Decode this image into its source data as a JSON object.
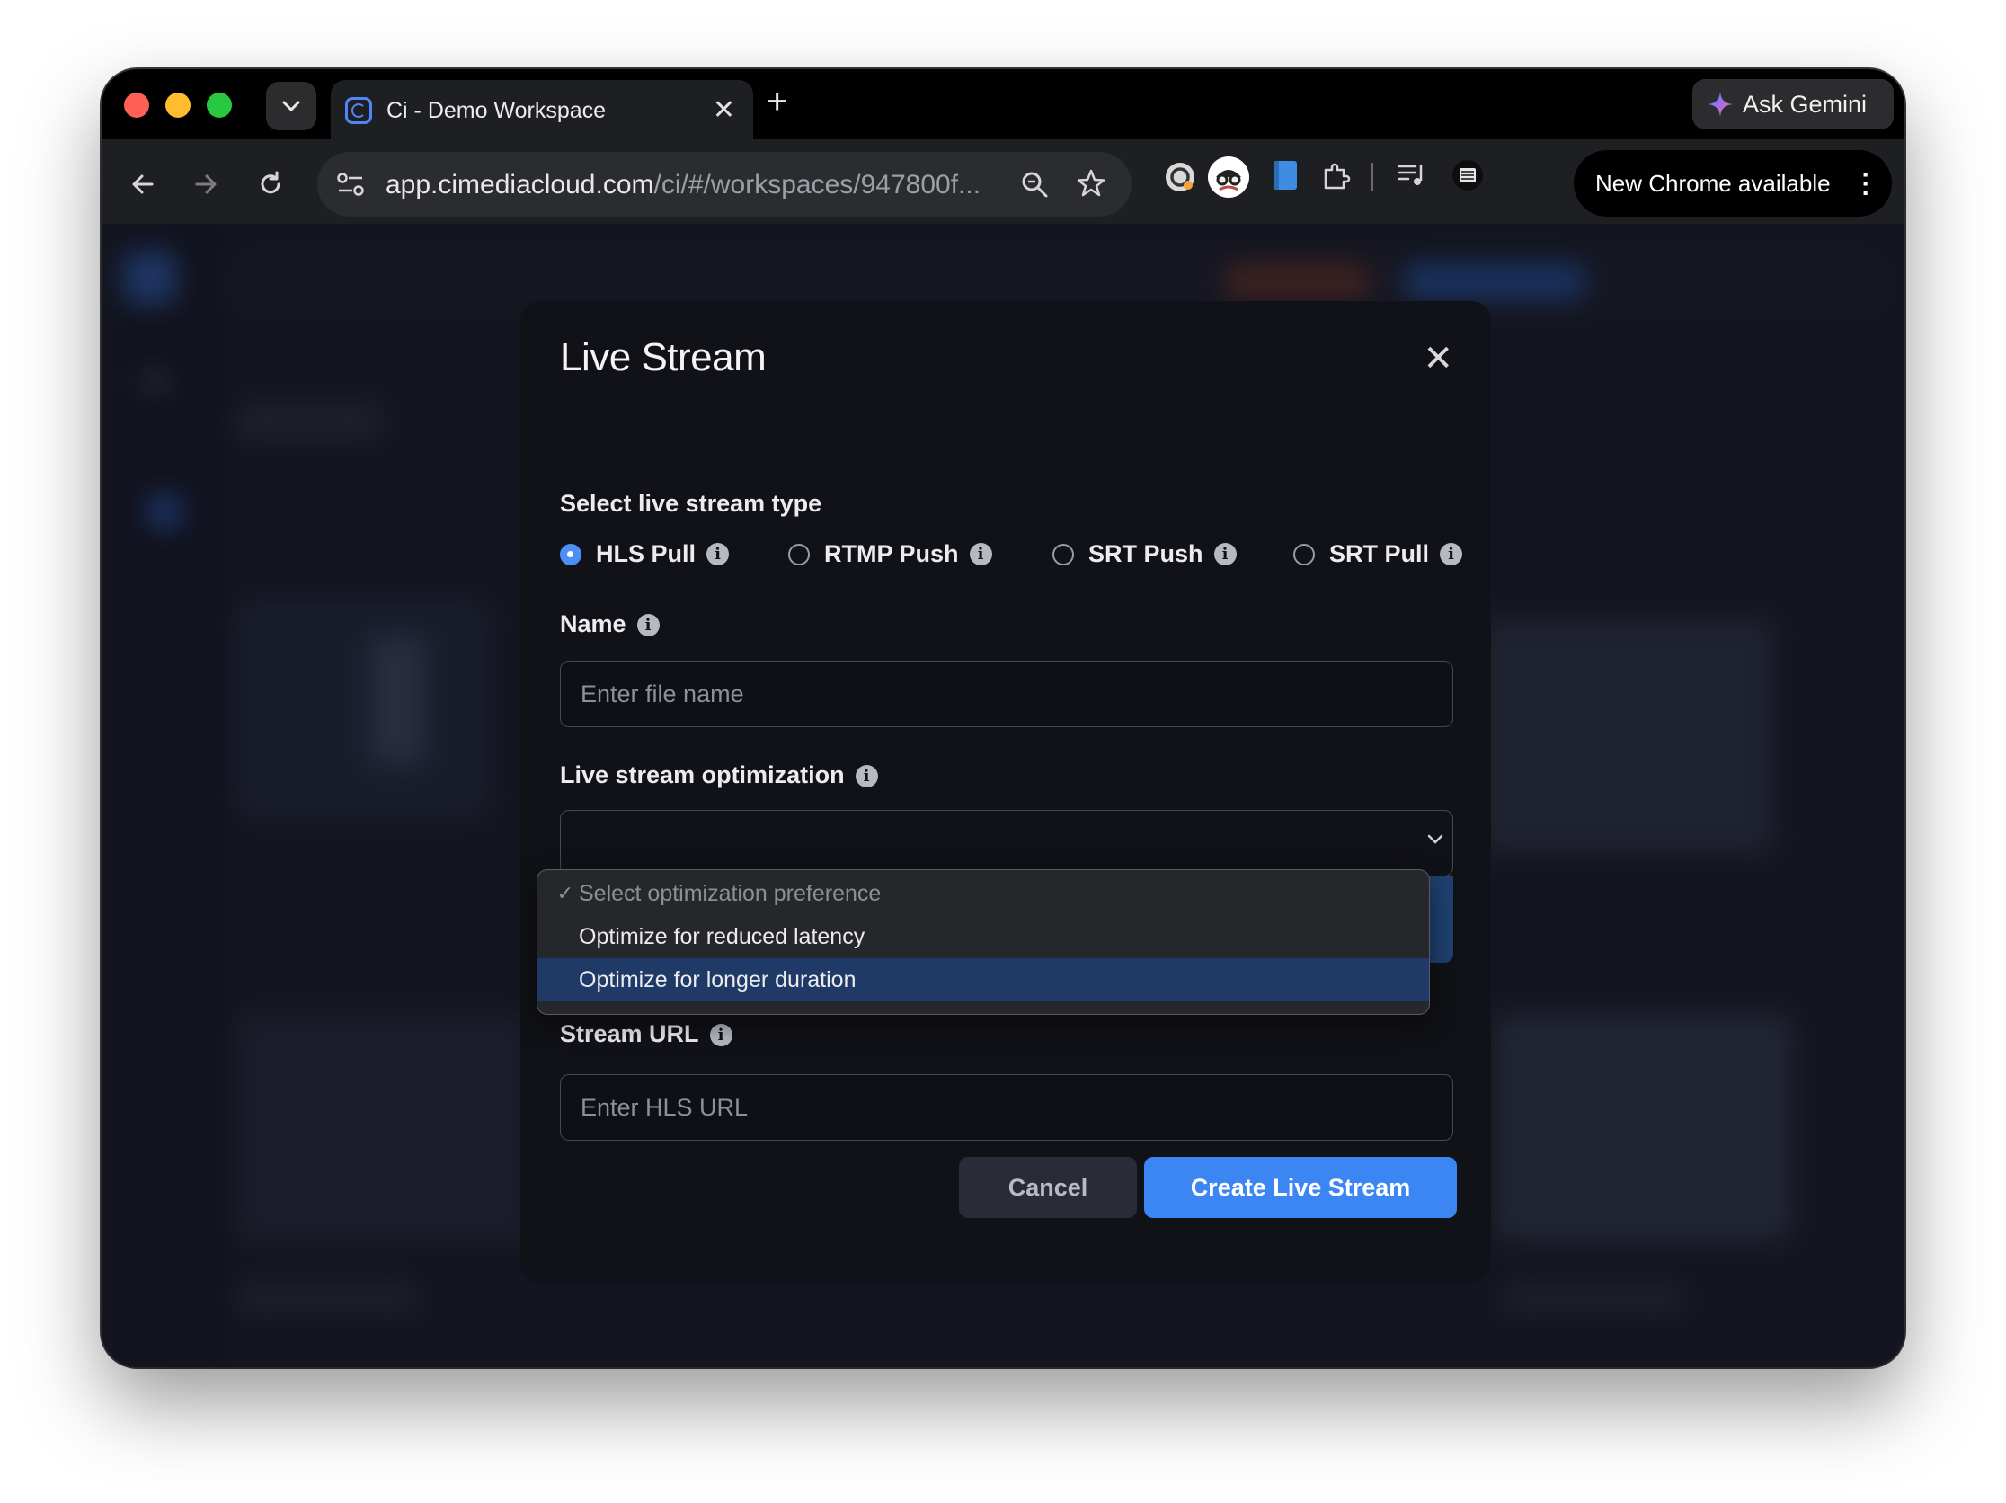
{
  "browser": {
    "tab": {
      "title": "Ci - Demo Workspace",
      "close_glyph": "✕"
    },
    "new_tab_glyph": "+",
    "ask_gemini_label": "Ask Gemini",
    "url_host": "app.cimediacloud.com",
    "url_path": "/ci/#/workspaces/947800f...",
    "update_label": "New Chrome available",
    "icons": [
      "tab-search-icon",
      "back-icon",
      "forward-icon",
      "reload-icon",
      "site-settings-icon",
      "zoom-icon",
      "bookmark-star-icon",
      "extension-icon",
      "puzzle-icon",
      "media-controls-icon",
      "menu-icon"
    ]
  },
  "modal": {
    "title": "Live Stream",
    "close_glyph": "✕",
    "stream_type_label": "Select live stream type",
    "stream_types": [
      {
        "label": "HLS Pull",
        "selected": true
      },
      {
        "label": "RTMP Push",
        "selected": false
      },
      {
        "label": "SRT Push",
        "selected": false
      },
      {
        "label": "SRT Pull",
        "selected": false
      }
    ],
    "name_label": "Name",
    "name_placeholder": "Enter file name",
    "optimization_label": "Live stream optimization",
    "optimization_options": [
      {
        "label": "Select optimization preference",
        "checked": true,
        "disabled": true
      },
      {
        "label": "Optimize for reduced latency",
        "checked": false
      },
      {
        "label": "Optimize for longer duration",
        "checked": false,
        "highlighted": true
      }
    ],
    "stream_url_label": "Stream URL",
    "stream_url_placeholder": "Enter HLS URL",
    "cancel_label": "Cancel",
    "create_label": "Create Live Stream",
    "info_glyph": "i"
  },
  "colors": {
    "accent": "#3b86f2",
    "modal_bg": "#111217",
    "highlight": "#1f3a66"
  }
}
